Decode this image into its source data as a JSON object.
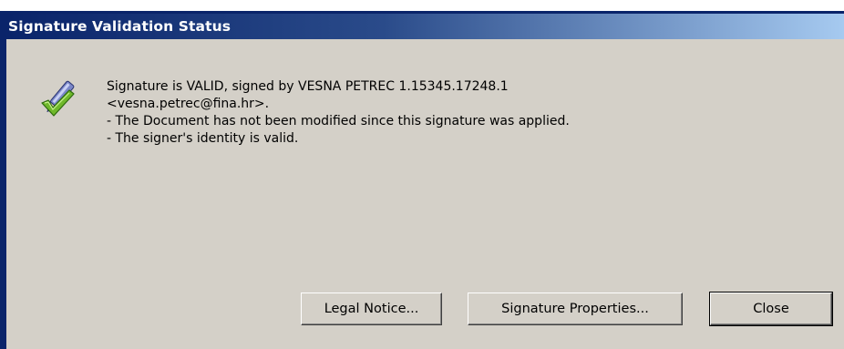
{
  "dialog": {
    "title": "Signature Validation Status",
    "icon": "valid-signature-pen-check-icon",
    "message_lines": [
      "Signature is VALID, signed by VESNA PETREC 1.15345.17248.1",
      "<vesna.petrec@fina.hr>.",
      "- The Document has not been modified since this signature was applied.",
      "- The signer's identity is valid."
    ]
  },
  "buttons": {
    "legal_notice": "Legal Notice...",
    "signature_properties": "Signature Properties...",
    "close": "Close"
  },
  "colors": {
    "titlebar_start": "#0a246a",
    "titlebar_end": "#a6caf0",
    "dialog_background": "#d4d0c8",
    "check_green": "#6fb82a"
  }
}
